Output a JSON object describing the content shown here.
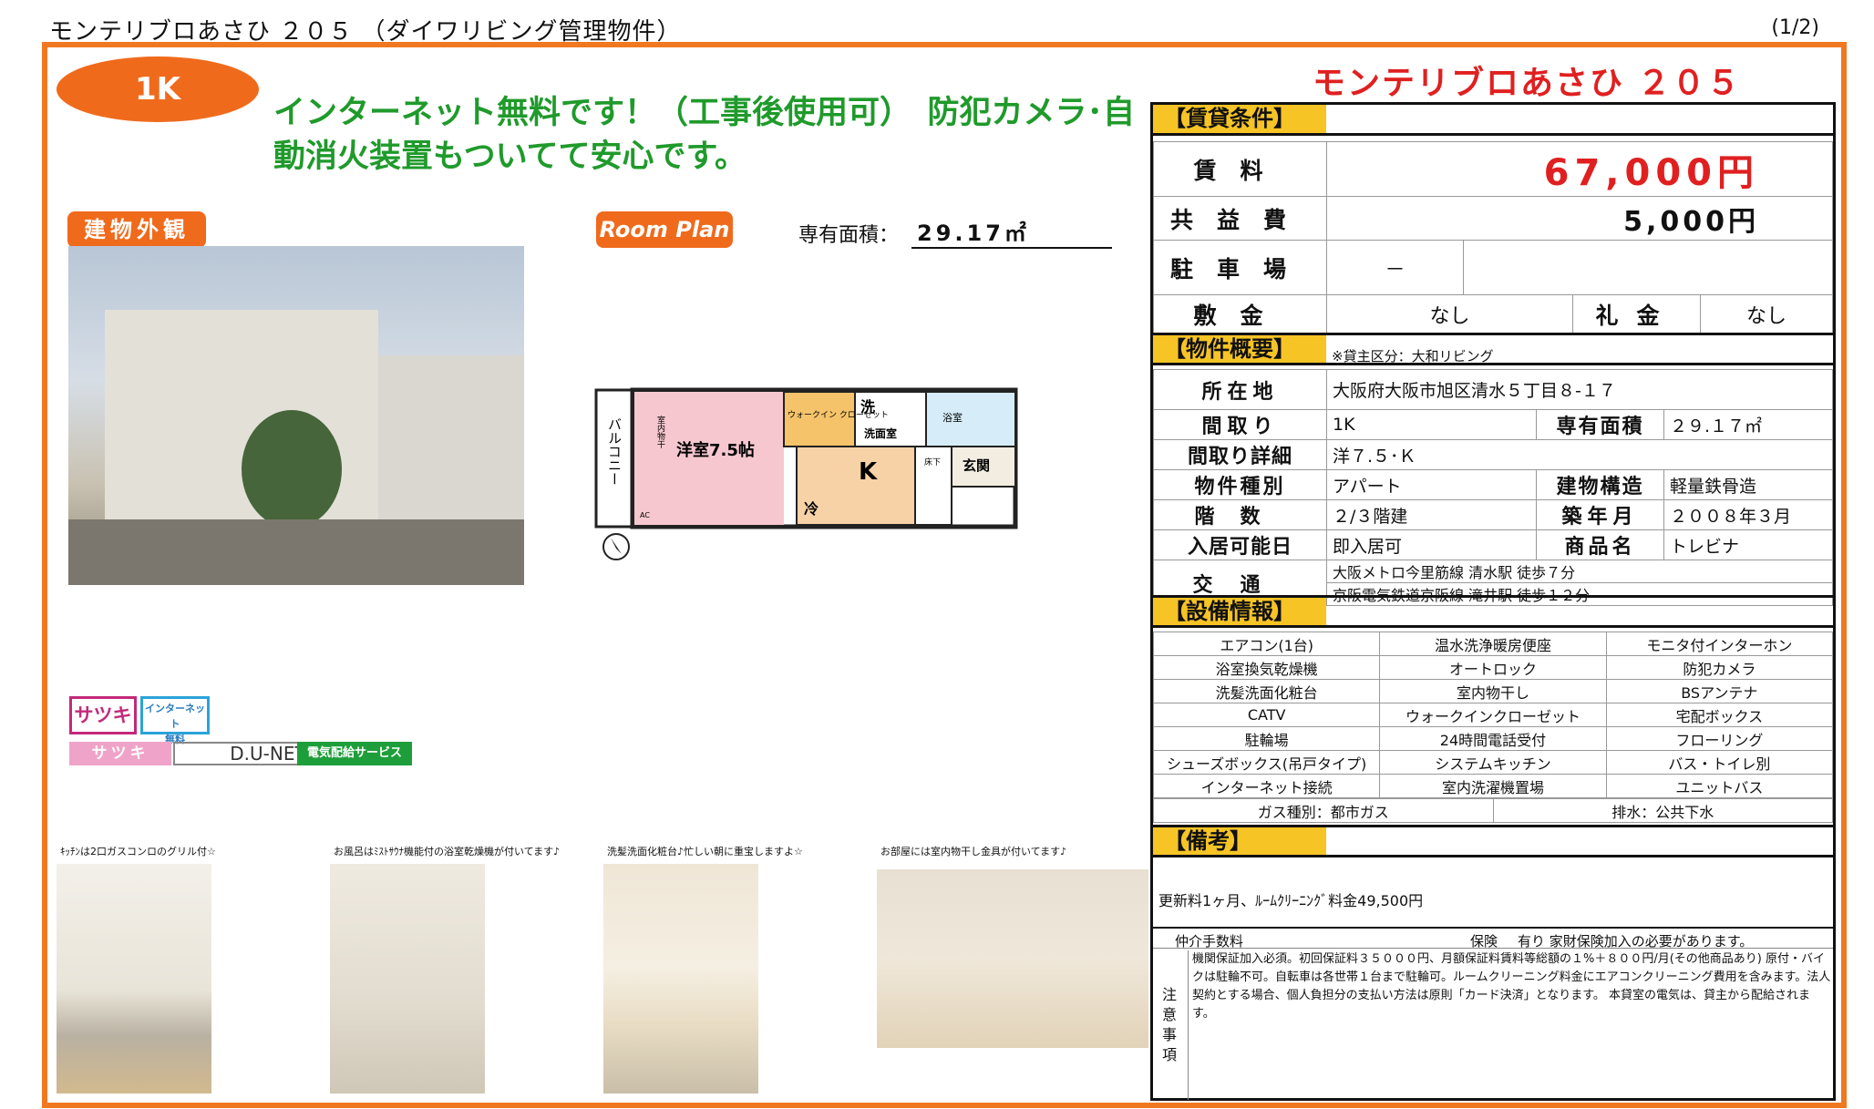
{
  "header": {
    "title": "モンテリブロあさひ ２０５ （ダイワリビング管理物件）",
    "page": "(1/2)"
  },
  "badge": "1K",
  "headline": "インターネット無料です！（工事後使用可）　防犯カメラ･自動消火装置もついてて安心です。",
  "labels": {
    "exterior": "建物外観",
    "room_plan": "Room Plan",
    "area_label": "専有面積：",
    "area_value": "29.17㎡"
  },
  "floorplan": {
    "balcony": "バルコニー",
    "indoor_dry": "室内物干",
    "western_room": "洋室7.5帖",
    "walkin": "ウォークイン\nクローゼット",
    "wash": "洗",
    "washroom": "洗面室",
    "bath": "浴室",
    "kitchen": "K",
    "under_floor": "床下",
    "entrance": "玄関",
    "fridge": "冷",
    "ac": "AC"
  },
  "logos": {
    "satsuki": "サツキ",
    "internet_free": "インターネット\n無料",
    "satsuki2": "サツキ",
    "dunet": "D.U-NET",
    "denki": "電気配給サービス"
  },
  "photos": [
    {
      "caption": "ｷｯﾁﾝは2口ガスコンロのグリル付☆"
    },
    {
      "caption": "お風呂はﾐｽﾄｻｳﾅ機能付の浴室乾燥機が付いてます♪"
    },
    {
      "caption": "洗髪洗面化粧台♪忙しい朝に重宝しますよ☆"
    },
    {
      "caption": "お部屋には室内物干し金具が付いてます♪"
    }
  ],
  "property_name": "モンテリブロあさひ ２０５",
  "rent_section": {
    "header": "【賃貸条件】",
    "rent_label": "賃料",
    "rent_value": "67,000円",
    "common_label": "共益費",
    "common_value": "5,000円",
    "parking_label": "駐車場",
    "parking_value": "－",
    "deposit_label": "敷金",
    "deposit_value": "なし",
    "key_money_label": "礼金",
    "key_money_value": "なし"
  },
  "overview": {
    "header": "【物件概要】",
    "note": "※貸主区分：大和リビング",
    "address_label": "所在地",
    "address": "大阪府大阪市旭区清水５丁目８-１７",
    "layout_label": "間取り",
    "layout": "1K",
    "area_label": "専有面積",
    "area": "２９.１７㎡",
    "layout_detail_label": "間取り詳細",
    "layout_detail": "洋７.５･Ｋ",
    "type_label": "物件種別",
    "type": "アパート",
    "structure_label": "建物構造",
    "structure": "軽量鉄骨造",
    "floor_label": "階数",
    "floor": "２/３階建",
    "built_label": "築年月",
    "built": "２００８年３月",
    "move_in_label": "入居可能日",
    "move_in": "即入居可",
    "product_label": "商品名",
    "product": "トレビナ",
    "transport_label": "交通",
    "transport1": "大阪メトロ今里筋線 清水駅 徒歩７分",
    "transport2": "京阪電気鉄道京阪線 滝井駅 徒歩１２分"
  },
  "equipment": {
    "header": "【設備情報】",
    "rows": [
      [
        "エアコン(1台)",
        "温水洗浄暖房便座",
        "モニタ付インターホン"
      ],
      [
        "浴室換気乾燥機",
        "オートロック",
        "防犯カメラ"
      ],
      [
        "洗髪洗面化粧台",
        "室内物干し",
        "BSアンテナ"
      ],
      [
        "CATV",
        "ウォークインクローゼット",
        "宅配ボックス"
      ],
      [
        "駐輪場",
        "24時間電話受付",
        "フローリング"
      ],
      [
        "シューズボックス(吊戸タイプ)",
        "システムキッチン",
        "バス・トイレ別"
      ],
      [
        "インターネット接続",
        "室内洗濯機置場",
        "ユニットバス"
      ]
    ],
    "gas": "ガス種別：都市ガス",
    "drain": "排水：公共下水"
  },
  "remarks": {
    "header": "【備考】",
    "renewal": "更新料1ヶ月、ﾙｰﾑｸﾘｰﾆﾝｸﾞ料金49,500円",
    "agent_fee_label": "仲介手数料",
    "insurance_label": "保険",
    "insurance_value": "有り 家財保険加入の必要があります。",
    "notes_label": "注意事項",
    "notes": "機関保証加入必須。初回保証料３５０００円、月額保証料賃料等総額の１%＋８００円/月(その他商品あり) 原付・バイクは駐輪不可。自転車は各世帯１台まで駐輪可。ルームクリーニング料金にエアコンクリーニング費用を含みます。法人契約とする場合、個人負担分の支払い方法は原則「カード決済」となります。 本貸室の電気は、貸主から配給されます。"
  }
}
